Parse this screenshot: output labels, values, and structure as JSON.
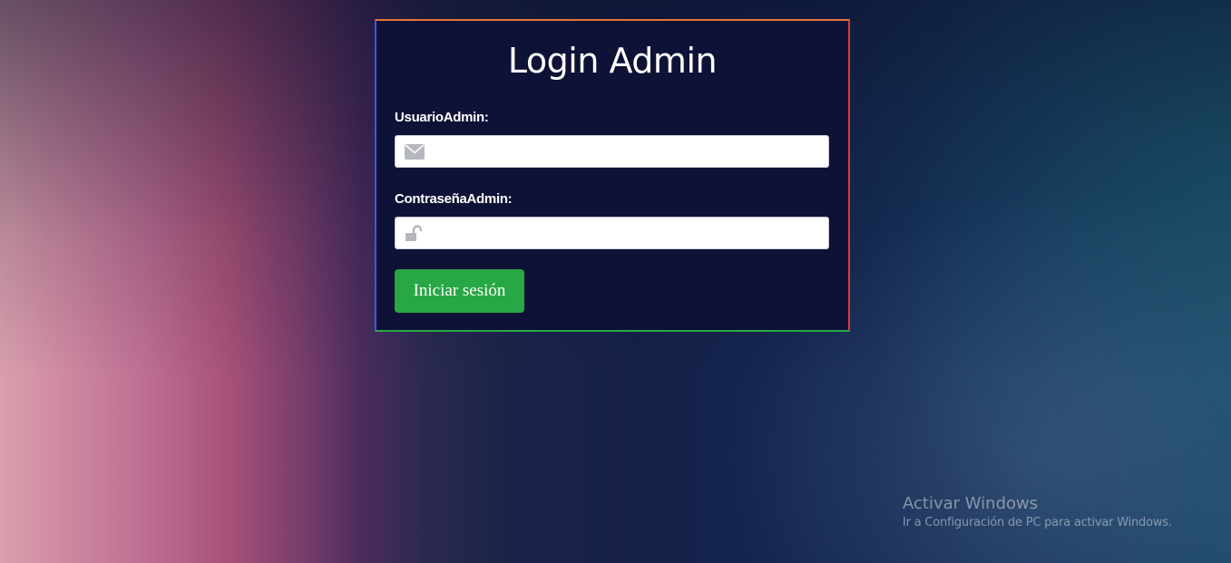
{
  "login": {
    "title": "Login Admin",
    "user_label": "UsuarioAdmin:",
    "user_value": "",
    "password_label": "ContraseñaAdmin:",
    "password_value": "",
    "submit_label": "Iniciar sesión",
    "user_icon": "envelope-icon",
    "password_icon": "unlock-icon"
  },
  "colors": {
    "card_background": "#0e1236",
    "button": "#28a745",
    "border_top": "#e8743a",
    "border_right": "#d93a3a",
    "border_bottom": "#27a845",
    "border_left": "#4856d6"
  },
  "watermark": {
    "title": "Activar Windows",
    "subtitle": "Ir a Configuración de PC para activar Windows."
  }
}
